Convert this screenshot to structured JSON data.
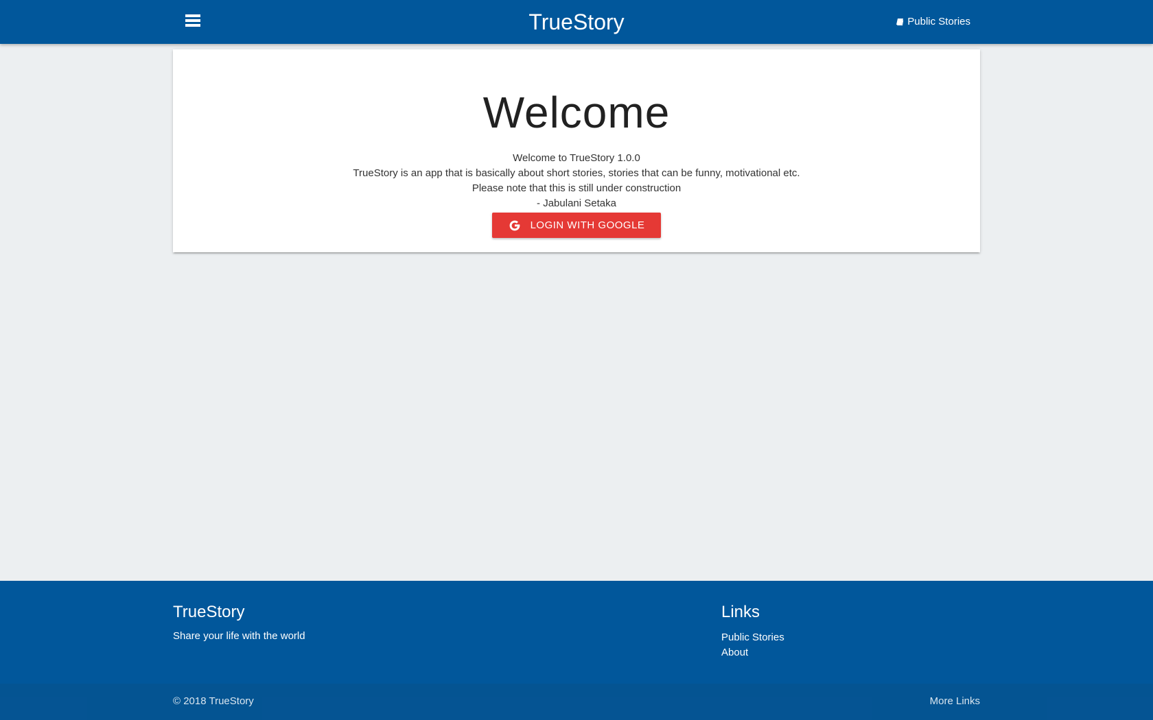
{
  "navbar": {
    "brand": "TrueStory",
    "menu_icon": "hamburger-menu-icon",
    "public_stories_icon": "book-icon",
    "public_stories_label": "Public Stories"
  },
  "card": {
    "title": "Welcome",
    "lines": [
      "Welcome to TrueStory 1.0.0",
      "TrueStory is an app that is basically about short stories, stories that can be funny, motivational etc.",
      "Please note that this is still under construction",
      "- Jabulani Setaka"
    ],
    "login_button_icon": "google-icon",
    "login_button_label": "LOGIN WITH GOOGLE"
  },
  "footer": {
    "brand": "TrueStory",
    "tagline": "Share your life with the world",
    "links_heading": "Links",
    "links": [
      "Public Stories",
      "About"
    ],
    "copyright": "© 2018 TrueStory",
    "more_links": "More Links"
  },
  "colors": {
    "primary": "#01579b",
    "background": "#eceff1",
    "google_button": "#e53935"
  }
}
